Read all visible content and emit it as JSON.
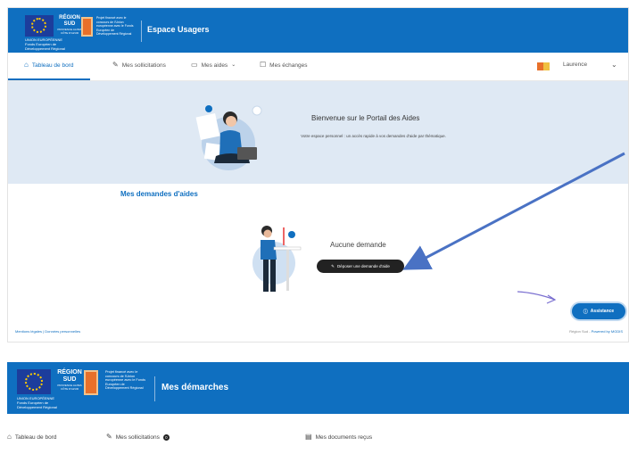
{
  "screen1": {
    "header": {
      "eu_text": "UNION EUROPÉENNE Fonds Européen de Développement Régional",
      "region_name": "RÉGION SUD",
      "region_sub": "PROVENCE ALPES CÔTE D'AZUR",
      "fund_text": "Projet financé avec le concours de l'Union européenne avec le Fonds Européen de Développement Régional",
      "app_title": "Espace Usagers"
    },
    "nav": {
      "dashboard": "Tableau de bord",
      "requests": "Mes sollicitations",
      "aids": "Mes aides",
      "exchanges": "Mes échanges",
      "user": "Laurence"
    },
    "hero": {
      "title": "Bienvenue sur le Portail des Aides",
      "subtitle": "Votre espace personnel : un accès rapide à vos demandes d'aide par thématique."
    },
    "section_title": "Mes demandes d'aides",
    "empty_state": {
      "title": "Aucune demande",
      "button": "Déposer une demande d'aide"
    },
    "assist_button": "Assistance",
    "footer": {
      "left": "Mentions légales | Données personnelles",
      "right_prefix": "Région Sud - ",
      "powered": "Powered by MGDIS"
    }
  },
  "screen2": {
    "header": {
      "eu_text": "UNION EUROPÉENNE Fonds Européen de Développement Régional",
      "region_name": "RÉGION SUD",
      "region_sub": "PROVENCE ALPES CÔTE D'AZUR",
      "fund_text": "Projet financé avec le concours de l'Union européenne avec le Fonds Européen de Développement Régional",
      "app_title": "Mes démarches"
    },
    "nav": {
      "dashboard": "Tableau de bord",
      "requests": "Mes sollicitations",
      "requests_badge": "0",
      "documents": "Mes documents reçus"
    }
  },
  "annotations": {
    "arrow_color": "#4a72c4",
    "hand_arrow_color": "#7a6fd0"
  },
  "colors": {
    "brand_blue": "#0f6fc0",
    "hero_bg": "#dfe9f4",
    "button_dark": "#222222"
  },
  "icons": [
    "home-icon",
    "pencil-icon",
    "folder-icon",
    "chat-icon",
    "document-icon",
    "question-icon"
  ]
}
